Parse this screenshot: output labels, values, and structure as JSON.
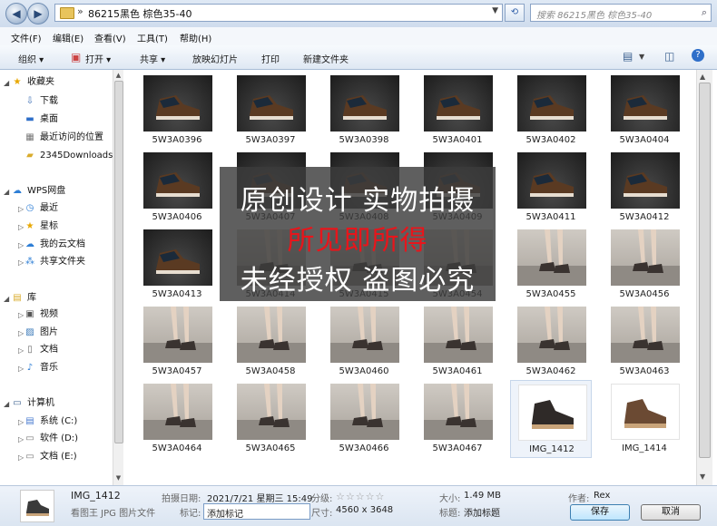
{
  "address": {
    "path": "86215黑色 棕色35-40",
    "search_placeholder": "搜索 86215黑色 棕色35-40"
  },
  "menu": [
    "文件(F)",
    "编辑(E)",
    "查看(V)",
    "工具(T)",
    "帮助(H)"
  ],
  "toolbar": {
    "organize": "组织 ▾",
    "open": "打开 ▾",
    "share": "共享 ▾",
    "slideshow": "放映幻灯片",
    "print": "打印",
    "new_folder": "新建文件夹"
  },
  "sidebar": {
    "favorites": "收藏夹",
    "downloads": "下载",
    "desktop": "桌面",
    "recent_places": "最近访问的位置",
    "downloads2345": "2345Downloads",
    "wps": "WPS网盘",
    "recent": "最近",
    "starred": "星标",
    "cloud_docs": "我的云文档",
    "shared_folder": "共享文件夹",
    "library": "库",
    "videos": "视频",
    "pictures": "图片",
    "documents": "文档",
    "music": "音乐",
    "computer": "计算机",
    "drive_c": "系统 (C:)",
    "drive_d": "软件 (D:)",
    "drive_e": "文档 (E:)"
  },
  "files": [
    {
      "name": "5W3A0396",
      "kind": "dark"
    },
    {
      "name": "5W3A0397",
      "kind": "dark"
    },
    {
      "name": "5W3A0398",
      "kind": "dark"
    },
    {
      "name": "5W3A0401",
      "kind": "dark"
    },
    {
      "name": "5W3A0402",
      "kind": "dark"
    },
    {
      "name": "5W3A0404",
      "kind": "dark"
    },
    {
      "name": "5W3A0406",
      "kind": "dark"
    },
    {
      "name": "5W3A0407",
      "kind": "dark"
    },
    {
      "name": "5W3A0408",
      "kind": "dark"
    },
    {
      "name": "5W3A0409",
      "kind": "dark"
    },
    {
      "name": "5W3A0411",
      "kind": "dark"
    },
    {
      "name": "5W3A0412",
      "kind": "dark"
    },
    {
      "name": "5W3A0413",
      "kind": "dark"
    },
    {
      "name": "5W3A0414",
      "kind": "floor"
    },
    {
      "name": "5W3A0415",
      "kind": "floor"
    },
    {
      "name": "5W3A0454",
      "kind": "floor"
    },
    {
      "name": "5W3A0455",
      "kind": "floor"
    },
    {
      "name": "5W3A0456",
      "kind": "floor"
    },
    {
      "name": "5W3A0457",
      "kind": "floor"
    },
    {
      "name": "5W3A0458",
      "kind": "floor"
    },
    {
      "name": "5W3A0460",
      "kind": "floor"
    },
    {
      "name": "5W3A0461",
      "kind": "floor"
    },
    {
      "name": "5W3A0462",
      "kind": "floor"
    },
    {
      "name": "5W3A0463",
      "kind": "floor"
    },
    {
      "name": "5W3A0464",
      "kind": "floor"
    },
    {
      "name": "5W3A0465",
      "kind": "floor"
    },
    {
      "name": "5W3A0466",
      "kind": "floor"
    },
    {
      "name": "5W3A0467",
      "kind": "floor"
    },
    {
      "name": "IMG_1412",
      "kind": "white"
    },
    {
      "name": "IMG_1414",
      "kind": "white"
    }
  ],
  "watermark": {
    "line1": "原创设计 实物拍摄",
    "line2": "所见即所得",
    "line3": "未经授权 盗图必究",
    "line2_color": "#e8151b"
  },
  "details": {
    "filename": "IMG_1412",
    "filetype": "看图王 JPG 图片文件",
    "date_label": "拍摄日期:",
    "date_value": "2021/7/21 星期三 15:49",
    "rating_label": "分级:",
    "rating_stars": "☆☆☆☆☆",
    "tags_label": "标记:",
    "tags_value": "添加标记",
    "dims_label": "尺寸:",
    "dims_value": "4560 x 3648",
    "size_label": "大小:",
    "size_value": "1.49 MB",
    "title_label": "标题:",
    "title_value": "添加标题",
    "author_label": "作者:",
    "author_value": "Rex",
    "save": "保存",
    "cancel": "取消"
  }
}
